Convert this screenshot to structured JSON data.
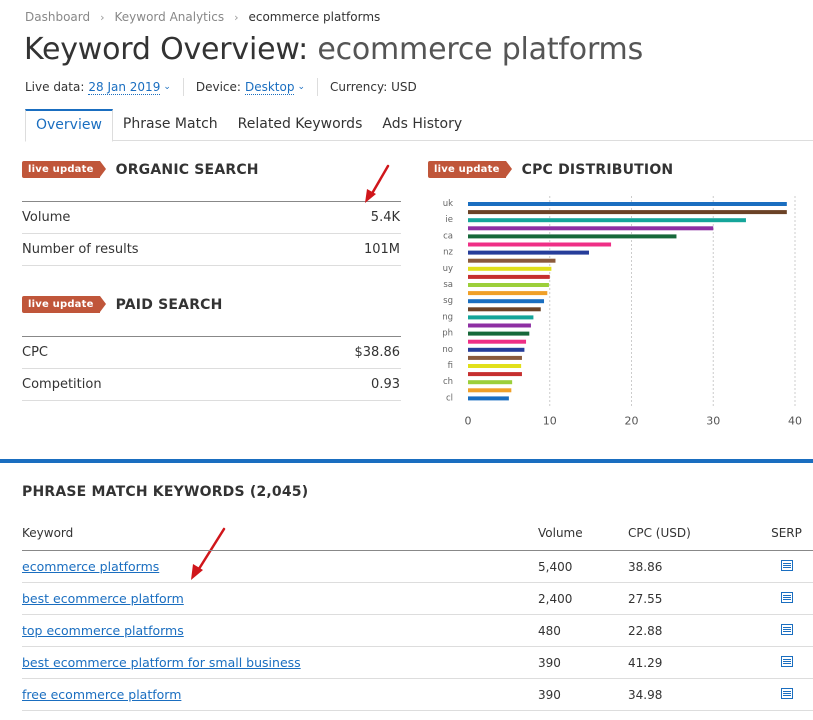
{
  "breadcrumb": {
    "items": [
      "Dashboard",
      "Keyword Analytics"
    ],
    "current": "ecommerce platforms"
  },
  "title": {
    "prefix": "Keyword Overview:",
    "query": "ecommerce platforms"
  },
  "meta": {
    "live_label": "Live data:",
    "live_value": "28 Jan 2019",
    "device_label": "Device:",
    "device_value": "Desktop",
    "currency": "Currency: USD"
  },
  "tabs": [
    "Overview",
    "Phrase Match",
    "Related Keywords",
    "Ads History"
  ],
  "badge_label": "live update",
  "organic": {
    "title": "ORGANIC SEARCH",
    "rows": [
      {
        "label": "Volume",
        "value": "5.4K"
      },
      {
        "label": "Number of results",
        "value": "101M"
      }
    ]
  },
  "paid": {
    "title": "PAID SEARCH",
    "rows": [
      {
        "label": "CPC",
        "value": "$38.86"
      },
      {
        "label": "Competition",
        "value": "0.93"
      }
    ]
  },
  "cpc_title": "CPC DISTRIBUTION",
  "chart_data": {
    "type": "bar",
    "orientation": "horizontal",
    "title": "CPC DISTRIBUTION",
    "categories": [
      "uk",
      "",
      "ie",
      "",
      "ca",
      "",
      "nz",
      "",
      "uy",
      "",
      "sa",
      "",
      "sg",
      "",
      "ng",
      "",
      "ph",
      "",
      "no",
      "",
      "fi",
      "",
      "ch",
      "",
      "cl"
    ],
    "values": [
      39,
      39,
      34,
      30,
      25.5,
      17.5,
      14.8,
      10.7,
      10.2,
      10,
      9.9,
      9.7,
      9.3,
      8.9,
      8,
      7.7,
      7.5,
      7.1,
      6.9,
      6.6,
      6.5,
      6.6,
      5.4,
      5.3,
      5
    ],
    "colors": [
      "#1a6ec0",
      "#6b4226",
      "#15a59a",
      "#8e2fa3",
      "#17683a",
      "#ef2f86",
      "#263d9a",
      "#8a5a3c",
      "#e1e01a",
      "#c62f2f",
      "#9ccf3a",
      "#f0a028",
      "#1a6ec0",
      "#6b4226",
      "#15a59a",
      "#8e2fa3",
      "#17683a",
      "#ef2f86",
      "#263d9a",
      "#8a5a3c",
      "#e1e01a",
      "#c62f2f",
      "#9ccf3a",
      "#f0a028",
      "#1a6ec0"
    ],
    "xlim": [
      0,
      40
    ],
    "xticks": [
      0,
      10,
      20,
      30,
      40
    ],
    "grid": true
  },
  "phrase_match": {
    "title": "PHRASE MATCH KEYWORDS (2,045)",
    "headers": [
      "Keyword",
      "Volume",
      "CPC (USD)",
      "SERP"
    ],
    "rows": [
      {
        "keyword": "ecommerce platforms",
        "volume": "5,400",
        "cpc": "38.86"
      },
      {
        "keyword": "best ecommerce platform",
        "volume": "2,400",
        "cpc": "27.55"
      },
      {
        "keyword": "top ecommerce platforms",
        "volume": "480",
        "cpc": "22.88"
      },
      {
        "keyword": "best ecommerce platform for small business",
        "volume": "390",
        "cpc": "41.29"
      },
      {
        "keyword": "free ecommerce platform",
        "volume": "390",
        "cpc": "34.98"
      }
    ]
  },
  "colors": {
    "accent": "#1a6ec0",
    "badge": "#c0563a",
    "arrow": "#d0161b"
  }
}
